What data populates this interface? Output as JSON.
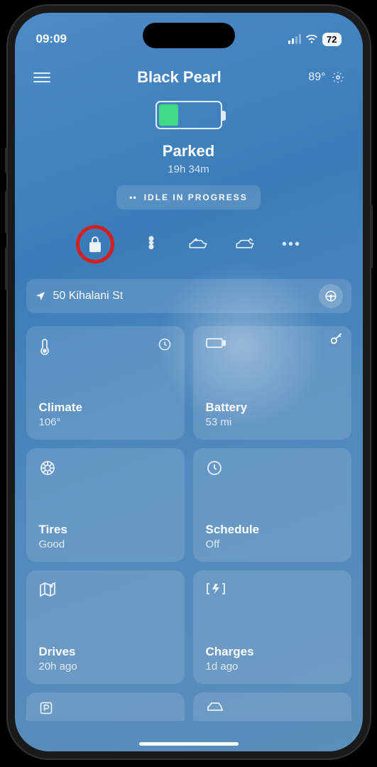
{
  "status": {
    "time": "09:09",
    "battery": "72"
  },
  "header": {
    "title": "Black Pearl",
    "temp": "89°"
  },
  "state": {
    "label": "Parked",
    "duration": "19h 34m",
    "idle": "IDLE IN PROGRESS"
  },
  "location": {
    "address": "50 Kihalani St"
  },
  "cards": {
    "climate": {
      "label": "Climate",
      "value": "106°"
    },
    "battery": {
      "label": "Battery",
      "value": "53 mi"
    },
    "tires": {
      "label": "Tires",
      "value": "Good"
    },
    "schedule": {
      "label": "Schedule",
      "value": "Off"
    },
    "drives": {
      "label": "Drives",
      "value": "20h ago"
    },
    "charges": {
      "label": "Charges",
      "value": "1d ago"
    }
  }
}
